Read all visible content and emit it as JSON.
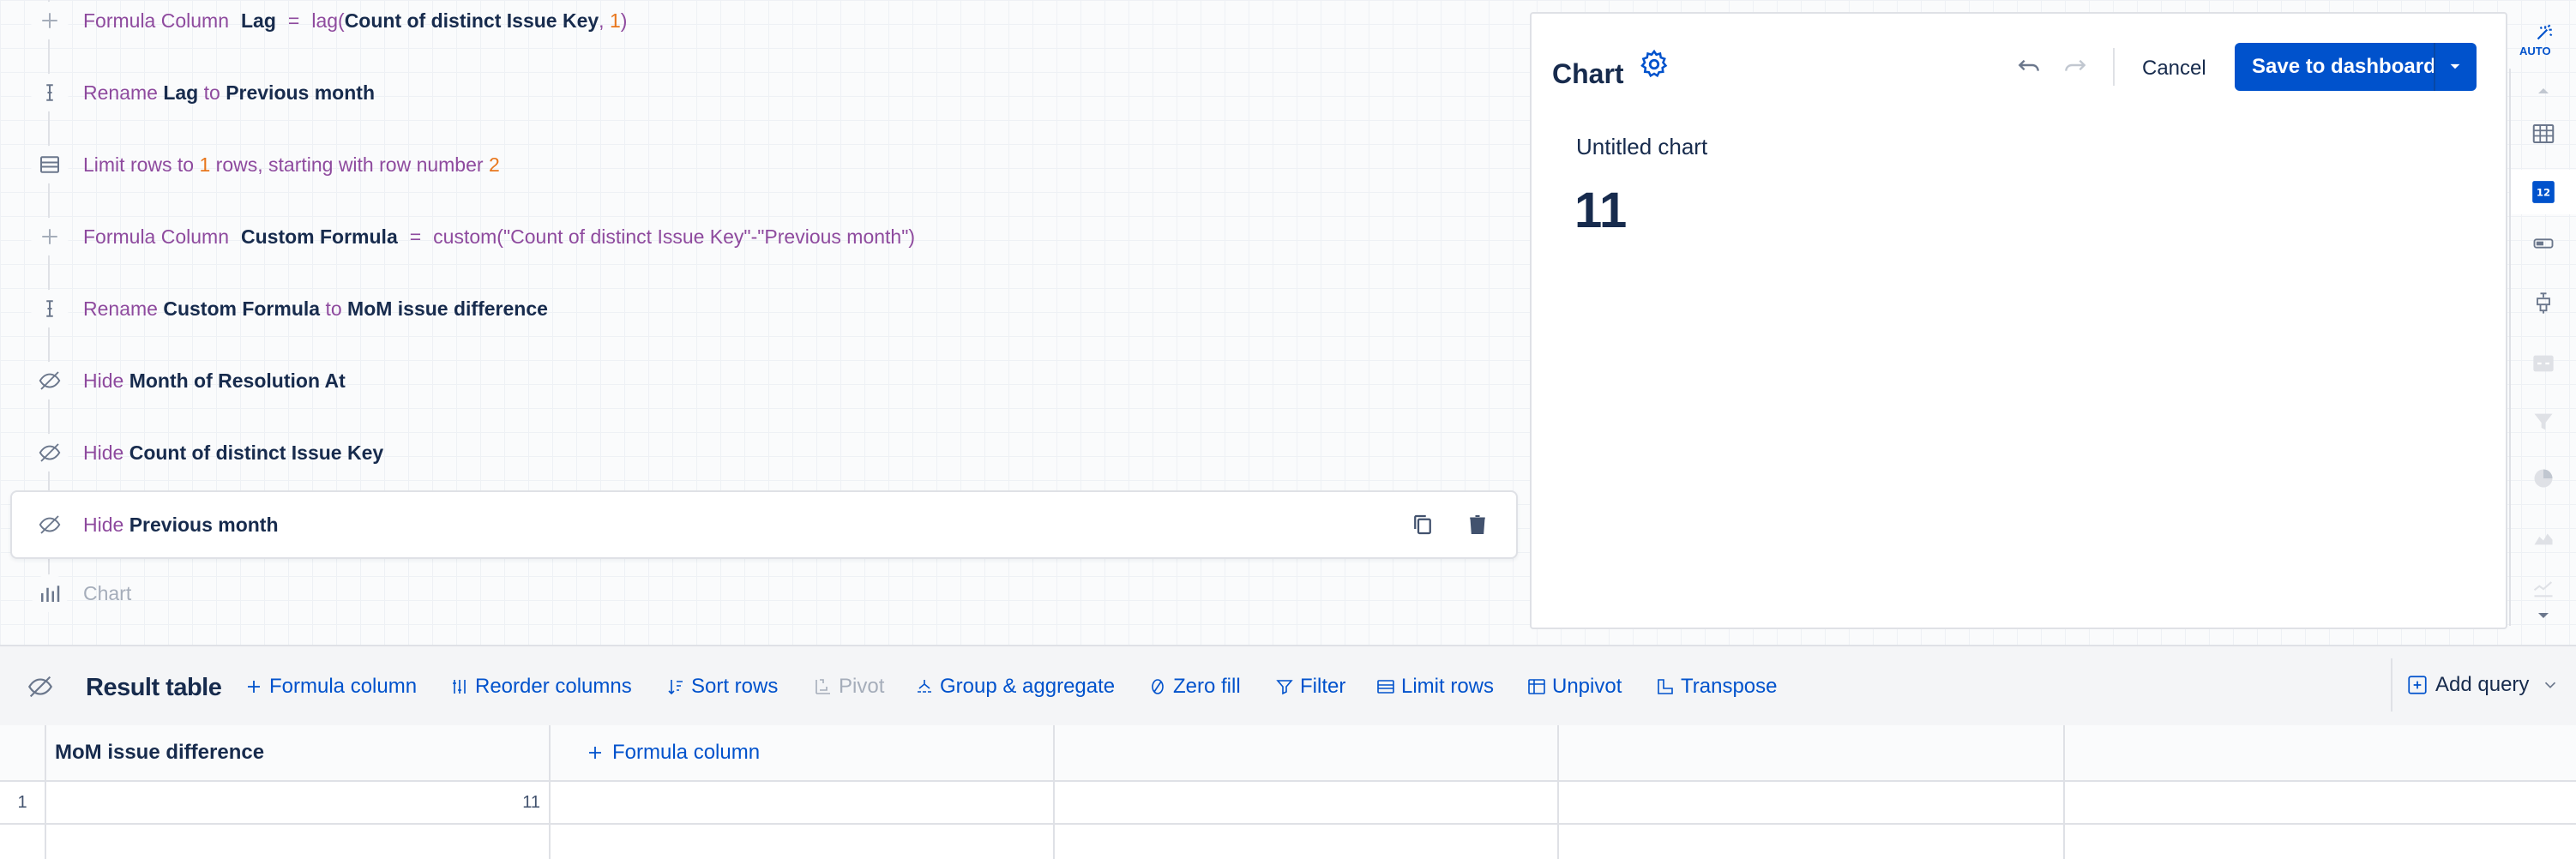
{
  "steps": [
    {
      "keyword": "Formula Column",
      "col": "Lag",
      "eq": "=",
      "func": "lag(",
      "arg": "Count of distinct Issue Key",
      "comma": ",",
      "n": "1",
      "close": ")"
    },
    {
      "keyword": "Rename",
      "from": "Lag",
      "to_kw": "to",
      "to": "Previous month"
    },
    {
      "keyword": "Limit rows to",
      "n": "1",
      "mid": "rows, starting with row number",
      "start": "2"
    },
    {
      "keyword": "Formula Column",
      "col": "Custom Formula",
      "eq": "=",
      "expr": "custom(\"Count of distinct Issue Key\"-\"Previous month\")"
    },
    {
      "keyword": "Rename",
      "from": "Custom Formula",
      "to_kw": "to",
      "to": "MoM issue difference"
    },
    {
      "keyword": "Hide",
      "target": "Month of Resolution At"
    },
    {
      "keyword": "Hide",
      "target": "Count of distinct Issue Key"
    },
    {
      "keyword": "Hide",
      "target": "Previous month"
    },
    {
      "keyword": "Chart"
    }
  ],
  "chart_panel": {
    "title": "Chart",
    "cancel": "Cancel",
    "save": "Save to dashboard",
    "chart_title": "Untitled chart",
    "value": "11"
  },
  "right_rail": {
    "auto_label": "AUTO",
    "number_badge": "12",
    "icons": [
      "auto-icon",
      "chevron-up-icon",
      "table-icon",
      "single-value-icon",
      "toggle-icon",
      "bar-chart-icon",
      "number-compare-icon",
      "funnel-icon",
      "pie-chart-icon",
      "area-chart-icon",
      "line-chart-icon",
      "chevron-down-icon"
    ]
  },
  "toolbar": {
    "title": "Result table",
    "buttons": [
      "Formula column",
      "Reorder columns",
      "Sort rows",
      "Pivot",
      "Group & aggregate",
      "Zero fill",
      "Filter",
      "Limit rows",
      "Unpivot",
      "Transpose"
    ],
    "add_query": "Add query"
  },
  "table": {
    "columns": [
      "MoM issue difference"
    ],
    "add_column": "Formula column",
    "rows": [
      {
        "index": "1",
        "values": [
          "11"
        ]
      }
    ]
  },
  "colors": {
    "accent": "#0052cc",
    "keyword": "#8e4a9e",
    "number": "#e8761c"
  }
}
